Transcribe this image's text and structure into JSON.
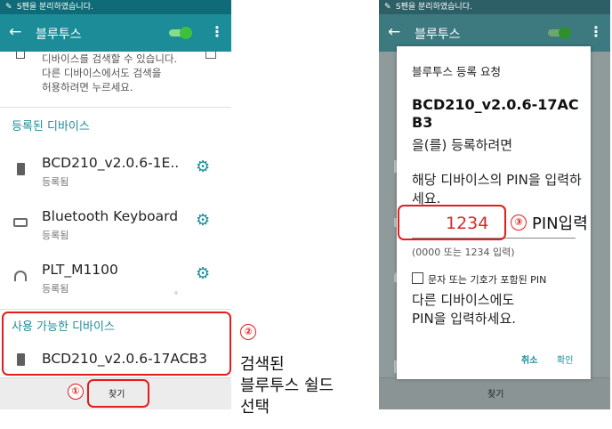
{
  "left": {
    "statusbar": "S펜을 분리하였습니다.",
    "appbar": {
      "title": "블루투스"
    },
    "description": [
      "디바이스를 검색할 수 있습니다.",
      "다른 디바이스에서도 검색을",
      "허용하려면 누르세요."
    ],
    "registered_section": "등록된 디바이스",
    "registered_devices": [
      {
        "name": "BCD210_v2.0.6-1E..",
        "status": "등록됨",
        "icon": "phone-icon"
      },
      {
        "name": "Bluetooth Keyboard",
        "status": "등록됨",
        "icon": "keyboard-icon"
      },
      {
        "name": "PLT_M1100",
        "status": "등록됨",
        "icon": "headset-icon"
      }
    ],
    "available_section": "사용 가능한 디바이스",
    "available_device": {
      "name": "BCD210_v2.0.6-17ACB3",
      "icon": "phone-icon"
    },
    "find_button": "찾기",
    "dot": "。"
  },
  "annotations": {
    "step1": "①",
    "step2": "②",
    "step3": "③",
    "note2": [
      "검색된",
      "블루투스 쉴드",
      "선택"
    ],
    "note3": "PIN입력",
    "highlight_color": "#e31c1c"
  },
  "right": {
    "statusbar": "S펜을 분리하였습니다.",
    "appbar": {
      "title": "블루투스"
    },
    "dialog": {
      "title": "블루투스 등록 요청",
      "device": "BCD210_v2.0.6-17ACB3",
      "suffix": "을(를) 등록하려면",
      "prompt": "해당 디바이스의 PIN을 입력하세요.",
      "pin_value": "1234",
      "pin_hint": "(0000 또는 1234 입력)",
      "checkbox_label": "문자 또는 기호가 포함된 PIN",
      "info": [
        "다른 디바이스에도",
        "PIN을 입력하세요."
      ],
      "cancel_label": "취소",
      "ok_label": "확인"
    },
    "find_button": "찾기"
  },
  "colors": {
    "accent": "#1a8d9a",
    "appbar": "#1c8c98",
    "statusbar": "#0f6b77",
    "toggle_on": "#3fbf3f"
  }
}
